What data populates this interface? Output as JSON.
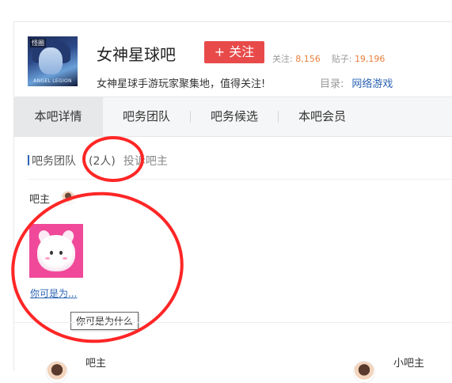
{
  "header": {
    "logo_badge": "怪圈",
    "logo_caption": "ANGEL LEGION",
    "forum_name": "女神星球吧",
    "follow_label": "+ 关注",
    "stats": {
      "follow_label": "关注:",
      "follow_count": "8,156",
      "posts_label": "贴子:",
      "posts_count": "19,196"
    },
    "slogan": "女神星球手游玩家聚集地，值得关注!",
    "category_label": "目录:",
    "category_link": "网络游戏"
  },
  "tabs": [
    {
      "label": "本吧详情",
      "active": true
    },
    {
      "label": "吧务团队",
      "active": false
    },
    {
      "label": "吧务候选",
      "active": false
    },
    {
      "label": "本吧会员",
      "active": false
    }
  ],
  "team": {
    "title": "吧务团队",
    "count": "(2人)",
    "complain": "投诉吧主",
    "owner_label": "吧主",
    "member_name": "你可是为...",
    "tooltip": "你可是为什么"
  },
  "lower": {
    "owner_label": "吧主",
    "small_owner_label": "小吧主"
  },
  "colors": {
    "accent_red": "#e84a4a",
    "link_blue": "#2d64b3",
    "stat_orange": "#e8803b",
    "annotation_red": "#ff2626"
  }
}
